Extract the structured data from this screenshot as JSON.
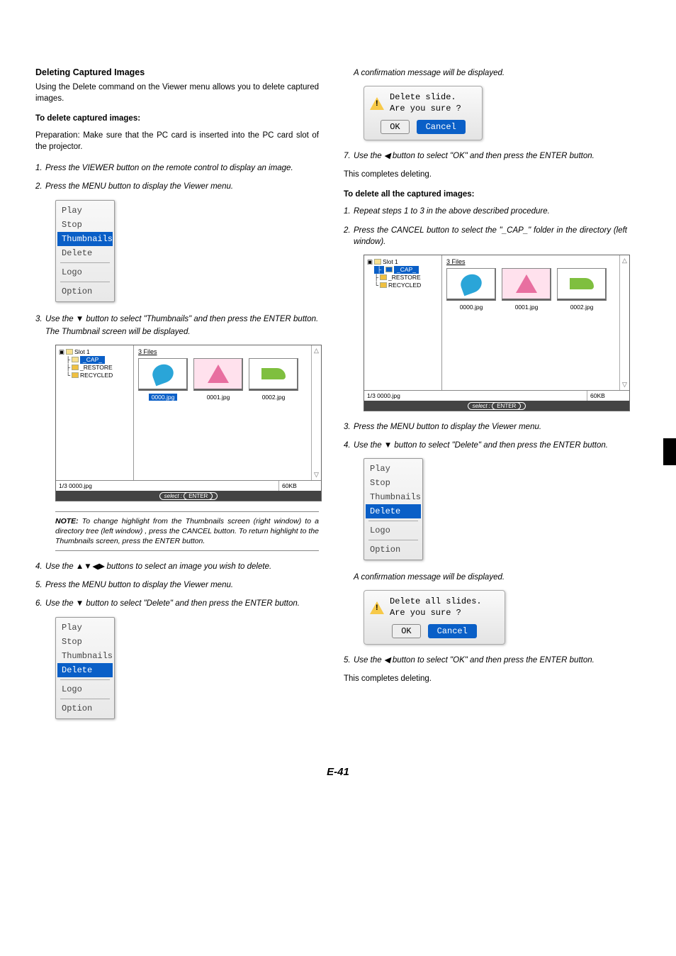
{
  "page_number": "E-41",
  "left": {
    "title": "Deleting Captured Images",
    "intro": "Using the Delete command on the Viewer menu allows you to delete captured images.",
    "heading1": "To delete captured images:",
    "prep": "Preparation: Make sure that the PC card is inserted into the PC card slot of the projector.",
    "step1": "Press the VIEWER button on the remote control to display an image.",
    "step2": "Press the MENU button to display the Viewer menu.",
    "step3": "Use the ▼ button to select \"Thumbnails\" and then press the ENTER button.",
    "step3_sub": "The Thumbnail screen will be displayed.",
    "note": "To change highlight from the Thumbnails screen (right window) to a directory tree (left window) , press the CANCEL button. To return highlight to the Thumbnails screen, press the ENTER button.",
    "step4": "Use the ▲▼◀▶ buttons to select an image you wish to delete.",
    "step5": "Press the MENU button to display the Viewer menu.",
    "step6": "Use the ▼ button to select \"Delete\" and then press the ENTER button."
  },
  "right": {
    "confirm_line": "A confirmation message will be displayed.",
    "step7": "Use the ◀ button to select \"OK\" and then press the ENTER button.",
    "complete": "This completes deleting.",
    "heading2": "To delete all the captured images:",
    "step1b": "Repeat steps 1 to 3 in the above described procedure.",
    "step2b": "Press the CANCEL button to select the \"_CAP_\" folder in the directory (left window).",
    "step3b": "Press the MENU button to display the Viewer menu.",
    "step4b": "Use the ▼ button to select \"Delete\" and then press the ENTER button.",
    "confirm_line2": "A confirmation message will be displayed.",
    "step5b": "Use the ◀ button to select \"OK\" and then press the ENTER button.",
    "complete2": "This completes deleting."
  },
  "menu": {
    "play": "Play",
    "stop": "Stop",
    "thumbnails": "Thumbnails",
    "delete": "Delete",
    "logo": "Logo",
    "option": "Option"
  },
  "dialog_slide": {
    "line1": "Delete slide.",
    "line2": "Are you sure ?",
    "ok": "OK",
    "cancel": "Cancel"
  },
  "dialog_all": {
    "line1": "Delete all slides.",
    "line2": "Are you sure ?",
    "ok": "OK",
    "cancel": "Cancel"
  },
  "thumb": {
    "root": "Slot 1",
    "folders": [
      "_CAP_",
      "_RESTORE",
      "RECYCLED"
    ],
    "files_label": "3 Files",
    "files": [
      "0000.jpg",
      "0001.jpg",
      "0002.jpg"
    ],
    "status_file": "1/3  0000.jpg",
    "status_size": "60KB",
    "status_hint_pre": "select :",
    "status_hint_btn": "ENTER"
  }
}
